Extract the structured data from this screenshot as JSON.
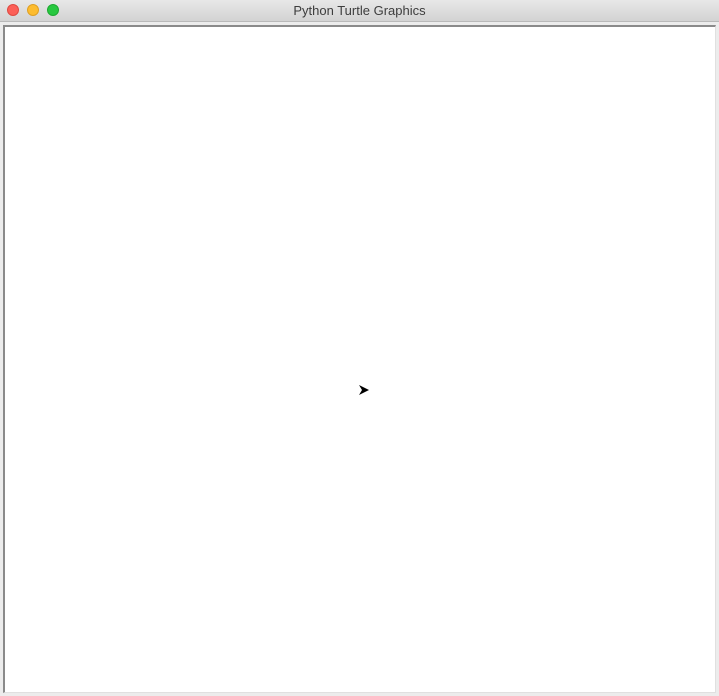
{
  "window": {
    "title": "Python Turtle Graphics"
  },
  "controls": {
    "close": "close-icon",
    "minimize": "minimize-icon",
    "maximize": "maximize-icon"
  },
  "colors": {
    "close": "#fc5f57",
    "minimize": "#fdbc2e",
    "maximize": "#28c840",
    "canvas": "#ffffff",
    "turtle": "#000000"
  },
  "turtle": {
    "icon": "turtle-arrow-icon",
    "heading": "east"
  }
}
